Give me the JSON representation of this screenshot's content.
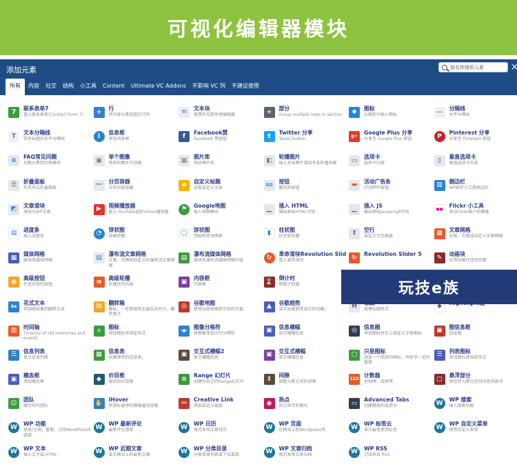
{
  "banner": {
    "title": "可视化编辑器模块"
  },
  "dialog": {
    "title": "添加元素",
    "search_placeholder": "按名称搜索元素",
    "close": "×",
    "tabs": [
      "所有",
      "内容",
      "社交",
      "结构",
      "小工具",
      "Content",
      "Ultimate VC Addons",
      "不影响 VC 列",
      "不建议使用"
    ],
    "active_tab": "所有"
  },
  "watermark": {
    "text": "玩技e族"
  },
  "elements": [
    {
      "name": "联系表单7",
      "desc": "置入联系表单(Contact Form 7)",
      "icon": "form-7-icon",
      "glyph": "7",
      "color": "#3c9c3d"
    },
    {
      "name": "行",
      "desc": "将内容元素放置在行内",
      "icon": "row-plus-icon",
      "glyph": "+",
      "color": "#3a7dcc"
    },
    {
      "name": "文本块",
      "desc": "使用所见即所得编辑器",
      "icon": "text-block-icon",
      "glyph": "Tt",
      "color": "#e8edf3",
      "fg": "#3a7dcc"
    },
    {
      "name": "部分",
      "desc": "Group multiple rows in section",
      "icon": "section-plus-icon",
      "glyph": "+",
      "color": "#5b6470"
    },
    {
      "name": "图标",
      "desc": "从图库中插入图标",
      "icon": "icon-element-icon",
      "glyph": "✹",
      "color": "#2a82d2"
    },
    {
      "name": "分隔线",
      "desc": "水平分隔线",
      "icon": "separator-icon",
      "glyph": "—",
      "color": "#eef1f4",
      "fg": "#8a96a3"
    },
    {
      "name": "文本分隔线",
      "desc": "带有标题的水平分隔线",
      "icon": "text-separator-icon",
      "glyph": "T",
      "color": "#eef1f4",
      "fg": "#3a7dcc"
    },
    {
      "name": "信息框",
      "desc": "添加消息框",
      "icon": "message-box-icon",
      "glyph": "i",
      "color": "#2a82d2",
      "circle": true
    },
    {
      "name": "Facebook赞",
      "desc": "Facebook 赞按钮",
      "icon": "facebook-icon",
      "glyph": "f",
      "color": "#3b5998"
    },
    {
      "name": "Twitter 分享",
      "desc": "Tweet button",
      "icon": "twitter-icon",
      "glyph": "t",
      "color": "#1da1f2"
    },
    {
      "name": "Google Plus 分享",
      "desc": "分享至 Google Plus 按钮",
      "icon": "google-plus-icon",
      "glyph": "g+",
      "color": "#d7412f"
    },
    {
      "name": "Pinterest 分享",
      "desc": "分享至 Pinterest 按钮",
      "icon": "pinterest-icon",
      "glyph": "P",
      "color": "#cb2027",
      "circle": true
    },
    {
      "name": "FAQ常见问题",
      "desc": "切换元素到问答模块",
      "icon": "faq-icon",
      "glyph": "≡",
      "color": "#e3e8ee",
      "fg": "#2a82d2"
    },
    {
      "name": "单个图像",
      "desc": "简单的图片与动画",
      "icon": "single-image-icon",
      "glyph": "▣",
      "color": "#e3e8ee",
      "fg": "#6b8e4e"
    },
    {
      "name": "图片库",
      "desc": "响应图片库",
      "icon": "image-gallery-icon",
      "glyph": "▦",
      "color": "#e3e8ee",
      "fg": "#6b8e4e"
    },
    {
      "name": "轮播图片",
      "desc": "插入多张图片增加多张轮播效果",
      "icon": "image-carousel-icon",
      "glyph": "◧",
      "color": "#e3e8ee",
      "fg": "#6b8e4e"
    },
    {
      "name": "选项卡",
      "desc": "选项卡内容",
      "icon": "tabs-icon",
      "glyph": "▭",
      "color": "#e3e8ee",
      "fg": "#5b6470"
    },
    {
      "name": "垂直选项卡",
      "desc": "垂直选项卡内容",
      "icon": "vertical-tabs-icon",
      "glyph": "▯",
      "color": "#e3e8ee",
      "fg": "#5b6470"
    },
    {
      "name": "折叠面板",
      "desc": "手风琴式折叠面板",
      "icon": "accordion-icon",
      "glyph": "☰",
      "color": "#e3e8ee",
      "fg": "#5b6470"
    },
    {
      "name": "分页容器",
      "desc": "分页内容容器",
      "icon": "pageable-container-icon",
      "glyph": "⋯",
      "color": "#e3e8ee",
      "fg": "#5b6470"
    },
    {
      "name": "自定义标题",
      "desc": "设置自定义文本",
      "icon": "custom-heading-icon",
      "glyph": "a",
      "color": "#f5b400"
    },
    {
      "name": "按钮",
      "desc": "醒目的按钮",
      "icon": "button-icon",
      "glyph": "GO",
      "color": "#e3e8ee",
      "fg": "#2a82d2"
    },
    {
      "name": "活动广告条",
      "desc": "行动呼吁按钮",
      "icon": "call-to-action-icon",
      "glyph": "▬",
      "color": "#e3e8ee",
      "fg": "#e85a2a"
    },
    {
      "name": "侧边栏",
      "desc": "WP部件小工具侧边栏",
      "icon": "widget-sidebar-icon",
      "glyph": "▥",
      "color": "#2a82d2"
    },
    {
      "name": "文章滑块",
      "desc": "滑块与WP文章",
      "icon": "posts-slider-icon",
      "glyph": "◩",
      "color": "#e3e8ee",
      "fg": "#2a82d2"
    },
    {
      "name": "视频播放器",
      "desc": "嵌入 YouTube或是Vimeo播放器",
      "icon": "video-player-icon",
      "glyph": "▶",
      "color": "#e5322d"
    },
    {
      "name": "Google地图",
      "desc": "插入地图模块",
      "icon": "google-maps-icon",
      "glyph": "⚑",
      "color": "#3c9c3d",
      "circle": true
    },
    {
      "name": "插入 HTML",
      "desc": "输出原始HTML代码",
      "icon": "raw-html-icon",
      "glyph": "▁",
      "color": "#e3e8ee",
      "fg": "#5b6470"
    },
    {
      "name": "插入 JS",
      "desc": "输出原始Javascript代码",
      "icon": "raw-js-icon",
      "glyph": "▁",
      "color": "#e3e8ee",
      "fg": "#5b6470"
    },
    {
      "name": "Flickr 小工具",
      "desc": "来自Flickr帐户的图像",
      "icon": "flickr-icon",
      "glyph": "●●",
      "color": "#ffffff",
      "fg": "#ff0084"
    },
    {
      "name": "进度条",
      "desc": "插入进度条",
      "icon": "progress-bar-icon",
      "glyph": "▤",
      "color": "#ffffff",
      "fg": "#2a82d2"
    },
    {
      "name": "饼状图",
      "desc": "动画饼图",
      "icon": "pie-chart-icon",
      "glyph": "◔",
      "color": "#2a82d2",
      "circle": true
    },
    {
      "name": "饼状图",
      "desc": "顶部简单饼图表",
      "icon": "round-chart-icon",
      "glyph": "◯",
      "color": "#ffffff",
      "fg": "#3c9c3d"
    },
    {
      "name": "柱状图",
      "desc": "柱状条形图",
      "icon": "bar-chart-icon",
      "glyph": "▮",
      "color": "#ffffff",
      "fg": "#2a82d2"
    },
    {
      "name": "空行",
      "desc": "自定义空白高度",
      "icon": "empty-space-icon",
      "glyph": "⇕",
      "color": "#e3e8ee",
      "fg": "#5b6470"
    },
    {
      "name": "文章网格",
      "desc": "文章，页面或自定义文章网格",
      "icon": "post-grid-icon",
      "glyph": "▦",
      "color": "#e85a2a"
    },
    {
      "name": "媒体网格",
      "desc": "媒体库媒体网格",
      "icon": "media-grid-icon",
      "glyph": "▦",
      "color": "#4a5cc0"
    },
    {
      "name": "瀑布流文章网格",
      "desc": "文章，页面和自定义的瀑布流文章网格",
      "icon": "masonry-grid-icon",
      "glyph": "▤",
      "color": "#e3e8ee",
      "fg": "#2a82d2",
      "wrap": true
    },
    {
      "name": "瀑布流媒体网格",
      "desc": "媒体库瀑布流媒体网格内容",
      "icon": "masonry-media-icon",
      "glyph": "▤",
      "color": "#3c9c3d"
    },
    {
      "name": "革命滑块Revolution Slider",
      "desc": "置入革命滑块",
      "icon": "revolution-slider-icon",
      "glyph": "↻",
      "color": "#e85a2a",
      "circle": true
    },
    {
      "name": "Revolution Slider 5",
      "desc": "",
      "icon": "revolution-slider-5-icon",
      "glyph": "↻",
      "color": "#e85a2a"
    },
    {
      "name": "动画块",
      "desc": "应用动画在任何页面",
      "icon": "animated-block-icon",
      "glyph": "✎",
      "color": "#8a2a2a"
    },
    {
      "name": "高级按钮",
      "desc": "打造创意的按钮",
      "icon": "advanced-button-icon",
      "glyph": "◉",
      "color": "#f5a623"
    },
    {
      "name": "高级轮播",
      "desc": "轮播任何内容",
      "icon": "advanced-carousel-icon",
      "glyph": "▮▮",
      "color": "#e85a2a"
    },
    {
      "name": "内容框",
      "desc": "内容框",
      "icon": "content-box-icon",
      "glyph": "▣",
      "color": "#7b3fa0"
    },
    {
      "name": "倒计时",
      "desc": "倒数计时器",
      "icon": "countdown-icon",
      "glyph": "⌛",
      "color": "#8a2a2a"
    },
    {
      "name": "",
      "desc": "",
      "icon": "hidden-by-watermark",
      "glyph": "",
      "color": "#ffffff"
    },
    {
      "name": "",
      "desc": "",
      "icon": "hidden-by-watermark",
      "glyph": "",
      "color": "#ffffff"
    },
    {
      "name": "花式文本",
      "desc": "带动画效果的翻转文本",
      "icon": "fancy-text-icon",
      "glyph": "Aa",
      "color": "#2a82d2"
    },
    {
      "name": "翻转箱",
      "desc": "图标，一些常规和主要反向符号，翻转盒子",
      "icon": "flip-box-icon",
      "glyph": "▤",
      "color": "#f5a623",
      "wrap": true
    },
    {
      "name": "谷歌地图",
      "desc": "使用谷歌地图提示你的位置",
      "icon": "google-map-ultimate-icon",
      "glyph": "◎",
      "color": "#c0392b"
    },
    {
      "name": "谷歌趋势",
      "desc": "显示谷歌趋势显示的见解。",
      "icon": "google-trends-icon",
      "glyph": "▲",
      "color": "#4a5cc0"
    },
    {
      "name": "标题",
      "desc": "真棒标题样式",
      "icon": "headings-icon",
      "glyph": "H",
      "color": "#e3e8ee",
      "fg": "#5b6470"
    },
    {
      "name": "Hightlight盒",
      "desc": "",
      "icon": "highlight-box-icon",
      "glyph": "◆",
      "color": "#ffffff",
      "fg": "#5b6470"
    },
    {
      "name": "时间轴",
      "desc": "Timeline of old memories and events",
      "icon": "timeline-icon",
      "glyph": "▥",
      "color": "#e85a2a",
      "wrap": true
    },
    {
      "name": "图标",
      "desc": "添加图标并指定样式",
      "icon": "icons-grid-icon",
      "glyph": "⁞⁞",
      "color": "#3c9c3d"
    },
    {
      "name": "图像分格符",
      "desc": "将图像添加为行分隔符",
      "icon": "image-separator-icon",
      "glyph": "-●-",
      "color": "#2a82d2"
    },
    {
      "name": "信息横幅",
      "desc": "显示横幅信息",
      "icon": "info-banner-icon",
      "glyph": "▣",
      "color": "#4a5cc0"
    },
    {
      "name": "信息圈",
      "desc": "添加图标并在上指定义字体图标",
      "icon": "info-circle-icon",
      "glyph": "◎",
      "color": "#2f3d4e"
    },
    {
      "name": "图信息框",
      "desc": "信息图",
      "icon": "info-box-img-icon",
      "glyph": "▣",
      "color": "#c0392b"
    },
    {
      "name": "信息列表",
      "desc": "显示信息列表",
      "icon": "info-list-icon",
      "glyph": "☰",
      "color": "#2a82d2"
    },
    {
      "name": "信息表",
      "desc": "创建漂亮的信息表。",
      "icon": "info-table-icon",
      "glyph": "▦",
      "color": "#3c9c3d"
    },
    {
      "name": "交互式横幅2",
      "desc": "显示横幅信息",
      "icon": "interactive-banner-2-icon",
      "glyph": "▣",
      "color": "#5b4a3a"
    },
    {
      "name": "交互式横幅",
      "desc": "显示横幅信息",
      "icon": "interactive-banner-icon",
      "glyph": "▣",
      "color": "#7b3fa0"
    },
    {
      "name": "只是图标",
      "desc": "添加一个简单的图标，并给予一定的链接",
      "icon": "just-icon-icon",
      "glyph": "▢",
      "color": "#3c9c3d",
      "wrap": true
    },
    {
      "name": "列表图标",
      "desc": "添加图标并指定样式",
      "icon": "list-icon-icon",
      "glyph": "☰",
      "color": "#4a5cc0"
    },
    {
      "name": "模态框",
      "desc": "添加模态框",
      "icon": "modal-box-icon",
      "glyph": "▣",
      "color": "#4a5cc0"
    },
    {
      "name": "价目框",
      "desc": "酷炫的价目表",
      "icon": "price-box-icon",
      "glyph": "◆",
      "color": "#1e5a6e"
    },
    {
      "name": "Range 幻灯片",
      "desc": "创建你自己的Range幻灯片",
      "icon": "range-slider-icon",
      "glyph": "≡",
      "color": "#3c9c3d"
    },
    {
      "name": "间隙",
      "desc": "调整元素之间的间隙",
      "icon": "spacer-gap-icon",
      "glyph": "⇕",
      "color": "#5b4a3a"
    },
    {
      "name": "计数器",
      "desc": "里程碑，成就等",
      "icon": "counter-icon",
      "glyph": "123",
      "color": "#e85a2a"
    },
    {
      "name": "悬浮部分",
      "desc": "使任何元素在任何内容内悬浮",
      "icon": "sticky-section-icon",
      "glyph": "▢",
      "color": "#8a2a2a"
    },
    {
      "name": "团队",
      "desc": "展示你的团队",
      "icon": "team-icon",
      "glyph": "☺",
      "color": "#3c9c3d"
    },
    {
      "name": "iHover",
      "desc": "带鼠标悬停的图像叠加效果",
      "icon": "ihover-icon",
      "glyph": "✋",
      "color": "#2a82d2"
    },
    {
      "name": "Creative Link",
      "desc": "添加自定义链接",
      "icon": "creative-link-icon",
      "glyph": "⚯",
      "color": "#c0392b"
    },
    {
      "name": "热点",
      "desc": "热点显示的图片",
      "icon": "hotspot-icon",
      "glyph": "◉",
      "color": "#c2185b"
    },
    {
      "name": "Advanced Tabs",
      "desc": "创建精美的选项卡",
      "icon": "advanced-tabs-icon",
      "glyph": "▭",
      "color": "#2f3d4e"
    },
    {
      "name": "WP 搜索",
      "desc": "插入搜索功能",
      "icon": "wp-search-icon",
      "glyph": "W",
      "color": "#21759b",
      "circle": true
    },
    {
      "name": "WP 功能",
      "desc": "登录/注销，管理，订阅WordPress的链接",
      "icon": "wp-meta-icon",
      "glyph": "W",
      "color": "#21759b",
      "circle": true,
      "wrap": true
    },
    {
      "name": "WP 最新评论",
      "desc": "最新评论清单",
      "icon": "wp-recent-comments-icon",
      "glyph": "W",
      "color": "#21759b",
      "circle": true
    },
    {
      "name": "WP 日历",
      "desc": "每月发布文章日历",
      "icon": "wp-calendar-icon",
      "glyph": "W",
      "color": "#21759b",
      "circle": true
    },
    {
      "name": "WP 页面",
      "desc": "在网站上的Wordpress页",
      "icon": "wp-pages-icon",
      "glyph": "W",
      "color": "#21759b",
      "circle": true
    },
    {
      "name": "WP 标签云",
      "desc": "显示最常使用标签",
      "icon": "wp-tag-cloud-icon",
      "glyph": "W",
      "color": "#21759b",
      "circle": true
    },
    {
      "name": "WP 自定义菜单",
      "desc": "使用自定义菜单",
      "icon": "wp-custom-menu-icon",
      "glyph": "W",
      "color": "#21759b",
      "circle": true
    },
    {
      "name": "WP 文本",
      "desc": "插入文字或 HTML",
      "icon": "wp-text-icon",
      "glyph": "W",
      "color": "#21759b",
      "circle": true
    },
    {
      "name": "WP 近期文章",
      "desc": "显示网站上的最新文章",
      "icon": "wp-recent-posts-icon",
      "glyph": "W",
      "color": "#21759b",
      "circle": true
    },
    {
      "name": "WP 分类目录",
      "desc": "分类目录列表或下拉菜单",
      "icon": "wp-categories-icon",
      "glyph": "W",
      "color": "#21759b",
      "circle": true
    },
    {
      "name": "WP 文章归档",
      "desc": "每月发布文章归档",
      "icon": "wp-archives-icon",
      "glyph": "W",
      "color": "#21759b",
      "circle": true
    },
    {
      "name": "WP RSS",
      "desc": "订阅来自 RSS",
      "icon": "wp-rss-icon",
      "glyph": "W",
      "color": "#21759b",
      "circle": true
    }
  ]
}
